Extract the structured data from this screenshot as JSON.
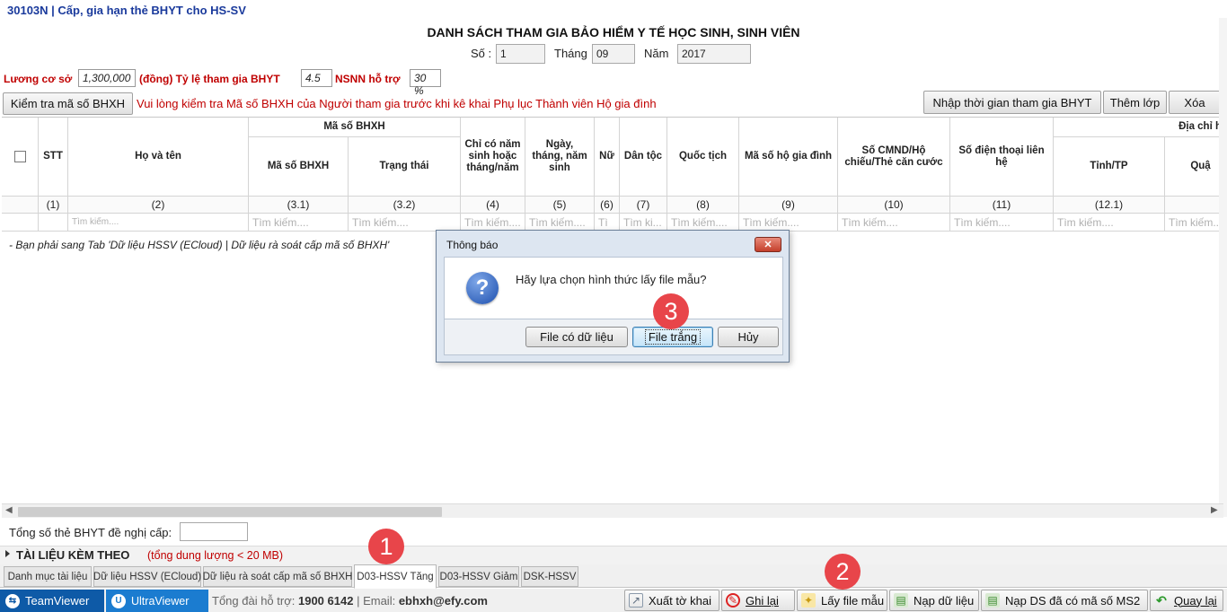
{
  "app": {
    "title": "30103N | Cấp, gia hạn thẻ BHYT cho HS-SV"
  },
  "form": {
    "title": "DANH SÁCH THAM GIA BẢO HIỂM Y TẾ HỌC SINH, SINH VIÊN",
    "so_label": "Số :",
    "so_value": "1",
    "thang_label": "Tháng",
    "thang_value": "09",
    "nam_label": "Năm",
    "nam_value": "2017",
    "luong_label": "Lương cơ sở",
    "luong_value": "1,300,000",
    "luong_unit": "(đồng) Tỷ lệ tham gia BHYT",
    "tyle_value": "4.5",
    "nsnn_label": "NSNN hỗ trợ",
    "nsnn_value": "30 %"
  },
  "toolbar": {
    "check_button": "Kiểm tra mã số BHXH",
    "note": "Vui lòng kiểm tra Mã số BHXH của Người tham gia trước khi kê khai Phụ lục Thành viên Hộ gia đình",
    "import_time_button": "Nhập thời gian tham gia BHYT",
    "add_class_button": "Thêm lớp",
    "delete_button": "Xóa"
  },
  "grid": {
    "group_ma_so": "Mã số BHXH",
    "group_dia_chi": "Địa chỉ h",
    "headers": {
      "stt": "STT",
      "ho_ten": "Họ và tên",
      "ma_so": "Mã số BHXH",
      "trang_thai": "Trạng thái",
      "chi_co_nam": "Chỉ có năm sinh hoặc tháng/năm",
      "ngay_sinh": "Ngày, tháng, năm sinh",
      "nu": "Nữ",
      "dan_toc": "Dân tộc",
      "quoc_tich": "Quốc tịch",
      "ma_ho": "Mã số hộ gia đình",
      "cmnd": "Số CMND/Hộ chiếu/Thẻ căn cước",
      "dien_thoai": "Số điện thoại liên hệ",
      "tinh": "Tỉnh/TP",
      "quan": "Quậ"
    },
    "numbers": [
      "(1)",
      "(2)",
      "(3.1)",
      "(3.2)",
      "(4)",
      "(5)",
      "(6)",
      "(7)",
      "(8)",
      "(9)",
      "(10)",
      "(11)",
      "(12.1)",
      "("
    ],
    "search_placeholders": {
      "ho_ten": "Tìm kiếm....",
      "ma_so": "Tìm kiếm....",
      "trang_thai": "Tìm kiếm....",
      "chi_co_nam": "Tìm kiếm....",
      "ngay_sinh": "Tìm kiếm....",
      "nu": "Tì",
      "dan_toc": "Tìm ki...",
      "quoc_tich": "Tìm kiếm....",
      "ma_ho": "Tìm kiếm....",
      "cmnd": "Tìm kiếm....",
      "dien_thoai": "Tìm kiếm....",
      "tinh": "Tìm kiếm....",
      "quan": "Tìm kiếm...."
    }
  },
  "hint": "- Bạn phải sang Tab 'Dữ liệu HSSV (ECloud) | Dữ liệu rà soát cấp mã số BHXH'",
  "total": {
    "label": "Tổng số thẻ BHYT đề nghị cấp:",
    "value": ""
  },
  "attachments": {
    "title": "TÀI LIỆU KÈM THEO",
    "note": "(tổng dung lượng < 20 MB)"
  },
  "tabs": [
    {
      "label": "Danh mục tài liệu"
    },
    {
      "label": "Dữ liệu HSSV (ECloud)"
    },
    {
      "label": "Dữ liệu rà soát cấp mã số BHXH"
    },
    {
      "label": "D03-HSSV Tăng"
    },
    {
      "label": "D03-HSSV Giảm"
    },
    {
      "label": "DSK-HSSV"
    }
  ],
  "statusbar": {
    "teamviewer": "TeamViewer",
    "ultraviewer": "UltraViewer",
    "support_label": "Tổng đài hỗ trợ:",
    "support_phone": "1900 6142",
    "separator": "|",
    "email_label": "Email:",
    "email": "ebhxh@efy.com",
    "buttons": {
      "export": "Xuất tờ khai",
      "save": "Ghi lại",
      "template": "Lấy file mẫu",
      "load": "Nạp dữ liệu",
      "load_ds": "Nạp DS đã có mã số MS2",
      "back": "Quay lại"
    }
  },
  "markers": [
    "1",
    "2",
    "3"
  ],
  "dialog": {
    "title": "Thông báo",
    "close": "✕",
    "message": "Hãy lựa chọn hình thức lấy file mẫu?",
    "btn_with_data": "File có dữ liệu",
    "btn_blank": "File trắng",
    "btn_cancel": "Hủy"
  }
}
